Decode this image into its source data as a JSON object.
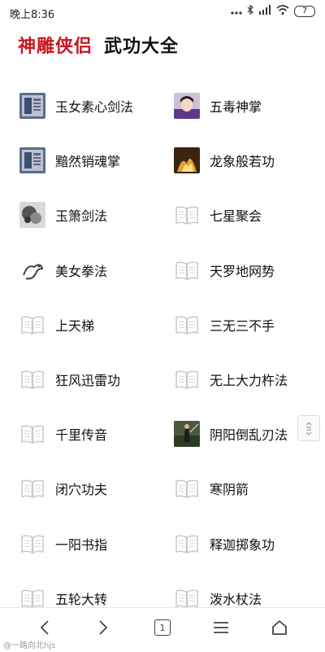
{
  "status": {
    "time": "晚上8:36",
    "battery": "7"
  },
  "header": {
    "brand": "神雕侠侣",
    "subtitle": "武功大全"
  },
  "items": [
    {
      "label": "玉女素心剑法",
      "icon": "book-image-icon"
    },
    {
      "label": "五毒神掌",
      "icon": "portrait-image-icon"
    },
    {
      "label": "黯然销魂掌",
      "icon": "book-image-icon"
    },
    {
      "label": "龙象般若功",
      "icon": "fire-image-icon"
    },
    {
      "label": "玉箫剑法",
      "icon": "ink-image-icon"
    },
    {
      "label": "七星聚会",
      "icon": "book-icon"
    },
    {
      "label": "美女拳法",
      "icon": "dragon-image-icon"
    },
    {
      "label": "天罗地网势",
      "icon": "book-icon"
    },
    {
      "label": "上天梯",
      "icon": "book-icon"
    },
    {
      "label": "三无三不手",
      "icon": "book-icon"
    },
    {
      "label": "狂风迅雷功",
      "icon": "book-icon"
    },
    {
      "label": "无上大力杵法",
      "icon": "book-icon"
    },
    {
      "label": "千里传音",
      "icon": "book-icon"
    },
    {
      "label": "阴阳倒乱刃法",
      "icon": "swordsman-image-icon"
    },
    {
      "label": "闭穴功夫",
      "icon": "book-icon"
    },
    {
      "label": "寒阴箭",
      "icon": "book-icon"
    },
    {
      "label": "一阳书指",
      "icon": "book-icon"
    },
    {
      "label": "释迦掷象功",
      "icon": "book-icon"
    },
    {
      "label": "五轮大转",
      "icon": "book-icon"
    },
    {
      "label": "泼水杖法",
      "icon": "book-icon"
    }
  ],
  "tab_count": "1",
  "watermark": "@一路向北hjs"
}
